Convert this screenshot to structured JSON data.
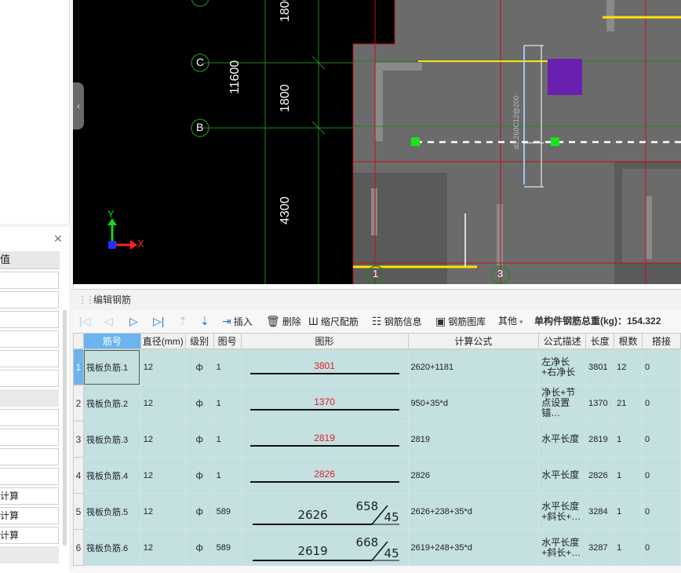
{
  "left_panel": {
    "header": "值",
    "rows": [
      "",
      "",
      "",
      "",
      "",
      "",
      "",
      "",
      "",
      "",
      "",
      "",
      "计算",
      "计算",
      "计算",
      ""
    ]
  },
  "cad": {
    "axis_labels": [
      "C",
      "B",
      "1",
      "3"
    ],
    "dimensions": [
      "1800",
      "11600",
      "1800",
      "4300"
    ],
    "axis_y": "Y",
    "axis_x": "X",
    "annotation": "d2:260C12@200",
    "colors": {
      "grid_red": "#c0101a",
      "grid_green": "#1f8a1f",
      "slab": "#6b6b6b",
      "rebar_yellow": "#ffe600",
      "purple": "#6a1fb0"
    }
  },
  "panel": {
    "title": "编辑钢筋",
    "toolbar": {
      "insert": "插入",
      "delete": "删除",
      "scale": "缩尺配筋",
      "info": "钢筋信息",
      "library": "钢筋图库",
      "other": "其他",
      "total": "单构件钢筋总重(kg)：154.322"
    },
    "columns": [
      "筋号",
      "直径(mm)",
      "级别",
      "图号",
      "图形",
      "计算公式",
      "公式描述",
      "长度",
      "根数",
      "搭接"
    ],
    "rows": [
      {
        "no": "1",
        "name": "筏板负筋.1",
        "dia": "12",
        "level": "ф",
        "fig": "1",
        "shape": "3801",
        "formula": "2620+1181",
        "desc": "左净长+右净长",
        "length": "3801",
        "count": "12",
        "lap": "0"
      },
      {
        "no": "2",
        "name": "筏板负筋.2",
        "dia": "12",
        "level": "ф",
        "fig": "1",
        "shape": "1370",
        "formula": "950+35*d",
        "desc": "净长+节点设置锚…",
        "length": "1370",
        "count": "21",
        "lap": "0"
      },
      {
        "no": "3",
        "name": "筏板负筋.3",
        "dia": "12",
        "level": "ф",
        "fig": "1",
        "shape": "2819",
        "formula": "2819",
        "desc": "水平长度",
        "length": "2819",
        "count": "1",
        "lap": "0"
      },
      {
        "no": "4",
        "name": "筏板负筋.4",
        "dia": "12",
        "level": "ф",
        "fig": "1",
        "shape": "2826",
        "formula": "2826",
        "desc": "水平长度",
        "length": "2826",
        "count": "1",
        "lap": "0"
      },
      {
        "no": "5",
        "name": "筏板负筋.5",
        "dia": "12",
        "level": "ф",
        "fig": "589",
        "shape_main": "2626",
        "shape_bend": "658",
        "shape_angle": "45",
        "formula": "2626+238+35*d",
        "desc": "水平长度+斜长+…",
        "length": "3284",
        "count": "1",
        "lap": "0"
      },
      {
        "no": "6",
        "name": "筏板负筋.6",
        "dia": "12",
        "level": "ф",
        "fig": "589",
        "shape_main": "2619",
        "shape_bend": "668",
        "shape_angle": "45",
        "formula": "2619+248+35*d",
        "desc": "水平长度+斜长+…",
        "length": "3287",
        "count": "1",
        "lap": "0"
      }
    ]
  }
}
